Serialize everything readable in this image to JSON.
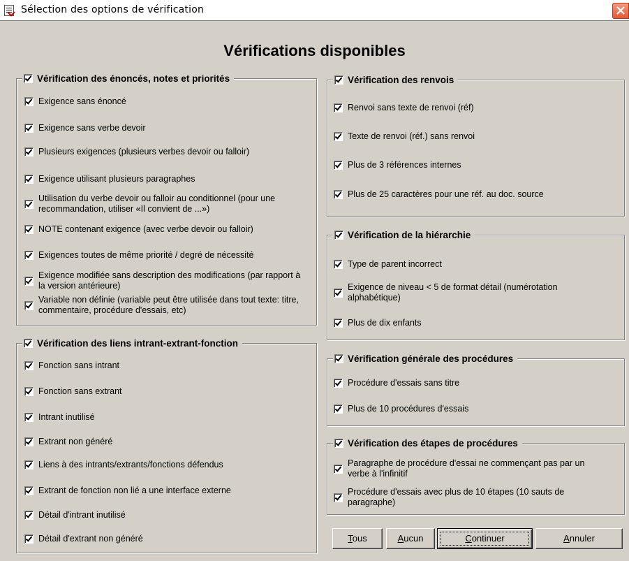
{
  "window": {
    "title": "Sélection des options de vérification",
    "close_icon": "close-x-icon",
    "app_icon": "checklist-icon"
  },
  "heading": "Vérifications disponibles",
  "groups": {
    "enonces": {
      "label": "Vérification des énoncés, notes et priorités",
      "checked": true,
      "items": [
        "Exigence sans énoncé",
        "Exigence sans verbe devoir",
        "Plusieurs exigences (plusieurs verbes devoir ou falloir)",
        "Exigence utilisant plusieurs paragraphes",
        "Utilisation du verbe devoir ou falloir au conditionnel (pour une recommandation, utiliser «Il convient de ...»)",
        "NOTE contenant exigence (avec verbe devoir ou falloir)",
        "Exigences toutes de même priorité / degré de nécessité",
        "Exigence modifiée sans description des modifications (par rapport à la version antérieure)",
        "Variable non définie (variable peut être utilisée dans tout texte: titre, commentaire, procédure d'essais, etc)"
      ]
    },
    "liens": {
      "label": "Vérification des liens intrant-extrant-fonction",
      "checked": true,
      "items": [
        "Fonction sans intrant",
        "Fonction sans extrant",
        "Intrant inutilisé",
        "Extrant non généré",
        "Liens à des intrants/extrants/fonctions défendus",
        "Extrant de fonction non lié a une interface externe",
        "Détail d'intrant inutilisé",
        "Détail d'extrant non généré"
      ]
    },
    "renvois": {
      "label": "Vérification des renvois",
      "checked": true,
      "items": [
        "Renvoi sans texte de renvoi (réf)",
        "Texte de renvoi (réf.) sans renvoi",
        "Plus de 3 références internes",
        "Plus de 25 caractères pour une réf. au doc. source"
      ]
    },
    "hierarchie": {
      "label": "Vérification de la hiérarchie",
      "checked": true,
      "items": [
        "Type de parent incorrect",
        "Exigence de niveau < 5 de format détail (numérotation alphabétique)",
        "Plus de dix enfants"
      ]
    },
    "procedures": {
      "label": "Vérification générale des procédures",
      "checked": true,
      "items": [
        "Procédure d'essais sans titre",
        "Plus de 10 procédures d'essais"
      ]
    },
    "etapes": {
      "label": "Vérification des étapes de procédures",
      "checked": true,
      "items": [
        "Paragraphe de procédure d'essai ne commençant pas par un verbe à l'infinitif",
        "Procédure d'essais avec plus de 10 étapes (10 sauts de paragraphe)"
      ]
    }
  },
  "buttons": {
    "tous": {
      "mnemonic": "T",
      "rest": "ous"
    },
    "aucun": {
      "mnemonic": "A",
      "rest": "ucun"
    },
    "continuer": {
      "mnemonic": "C",
      "rest": "ontinuer"
    },
    "annuler": {
      "mnemonic": "A",
      "rest": "nnuler"
    }
  }
}
